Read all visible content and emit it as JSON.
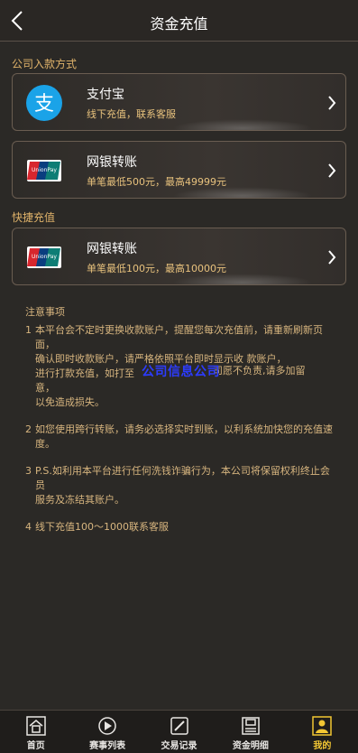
{
  "header": {
    "title": "资金充值"
  },
  "sections": {
    "company": "公司入款方式",
    "quick": "快捷充值"
  },
  "cards": [
    {
      "name": "支付宝",
      "sub": "线下充值，联系客服",
      "icon": "alipay-icon"
    },
    {
      "name": "网银转账",
      "sub": "单笔最低500元，最高49999元",
      "icon": "unionpay-icon"
    },
    {
      "name": "网银转账",
      "sub": "单笔最低100元，最高10000元",
      "icon": "unionpay-icon"
    }
  ],
  "notes": {
    "heading": "注意事项",
    "items": [
      {
        "num": "1",
        "text": "本平台会不定时更换收款账户，提醒您每次充值前，请重新刷新页面，\n确认即时收款账户，请严格依照平台即时显示收 款账户，\n进行打款充值，如打至\n意，\n以免造成损失。",
        "tail": "司愿不负责,请多加留"
      },
      {
        "num": "2",
        "text": "如您使用跨行转账，请务必选择实时到账，以利系统加快您的充值速度。"
      },
      {
        "num": "3",
        "text": "P.S.如利用本平台进行任何洗钱诈骗行为，本公司将保留权利终止会员\n服务及冻结其账户。"
      },
      {
        "num": "4",
        "text": "线下充值100～1000联系客服"
      }
    ]
  },
  "overlay_text": "公司信息公司",
  "tabs": [
    {
      "label": "首页",
      "icon": "home-icon"
    },
    {
      "label": "赛事列表",
      "icon": "event-list-icon"
    },
    {
      "label": "交易记录",
      "icon": "trade-record-icon"
    },
    {
      "label": "资金明细",
      "icon": "funds-detail-icon"
    },
    {
      "label": "我的",
      "icon": "user-icon",
      "active": true
    }
  ],
  "colors": {
    "accent": "#e0b36a",
    "active_tab": "#f2c633",
    "background": "#2b2926"
  }
}
